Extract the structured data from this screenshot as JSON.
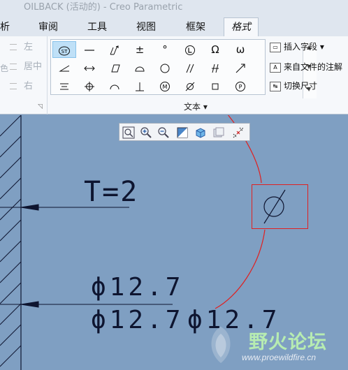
{
  "window": {
    "title": "OILBACK (活动的) - Creo Parametric"
  },
  "tabs": [
    {
      "label": "析"
    },
    {
      "label": "审阅"
    },
    {
      "label": "工具"
    },
    {
      "label": "视图"
    },
    {
      "label": "框架"
    },
    {
      "label": "格式"
    }
  ],
  "align_group": {
    "left": "左",
    "center": "居中",
    "right": "右",
    "side": "色"
  },
  "symbol_group": {
    "label": "文本",
    "symbols": [
      {
        "name": "statistical-tolerance",
        "glyph": "ST"
      },
      {
        "name": "flatness",
        "glyph": "—"
      },
      {
        "name": "total-runout",
        "glyph": "⌰"
      },
      {
        "name": "plus-minus",
        "glyph": "±"
      },
      {
        "name": "degree",
        "glyph": "°"
      },
      {
        "name": "lmc",
        "glyph": "Ⓛ"
      },
      {
        "name": "ohm",
        "glyph": "Ω"
      },
      {
        "name": "omega",
        "glyph": "ω"
      },
      {
        "name": "angularity",
        "glyph": "∠"
      },
      {
        "name": "between",
        "glyph": "↔"
      },
      {
        "name": "cylindricity",
        "glyph": "⌭"
      },
      {
        "name": "profile-surface",
        "glyph": "⌓"
      },
      {
        "name": "circularity",
        "glyph": "○"
      },
      {
        "name": "parallelism",
        "glyph": "//"
      },
      {
        "name": "projected",
        "glyph": "⌿"
      },
      {
        "name": "circular-runout",
        "glyph": "↗"
      },
      {
        "name": "symmetry",
        "glyph": "⌯"
      },
      {
        "name": "position",
        "glyph": "⌖"
      },
      {
        "name": "profile-line",
        "glyph": "⌒"
      },
      {
        "name": "perpendicularity",
        "glyph": "⊥"
      },
      {
        "name": "mmc",
        "glyph": "Ⓜ"
      },
      {
        "name": "diameter",
        "glyph": "⌀"
      },
      {
        "name": "square",
        "glyph": "□"
      },
      {
        "name": "projected-tolerance",
        "glyph": "Ⓟ"
      }
    ]
  },
  "commands": {
    "insert_field": "插入字段",
    "note_from_file": "来自文件的注解",
    "toggle_dimension": "切换尺寸"
  },
  "canvas": {
    "dim_t": "T=2",
    "dim_top": "ϕ12.7",
    "dim_bottom": "ϕ12.7",
    "dim_new": "ϕ12.7",
    "callout_symbol": "⌀"
  },
  "watermark": {
    "title": "野火论坛",
    "site": "www.proewildfire.cn"
  },
  "colors": {
    "canvas_bg": "#7f9fc2",
    "annotation_red": "#e02020",
    "selected_symbol_bg": "#bfe0f7"
  }
}
